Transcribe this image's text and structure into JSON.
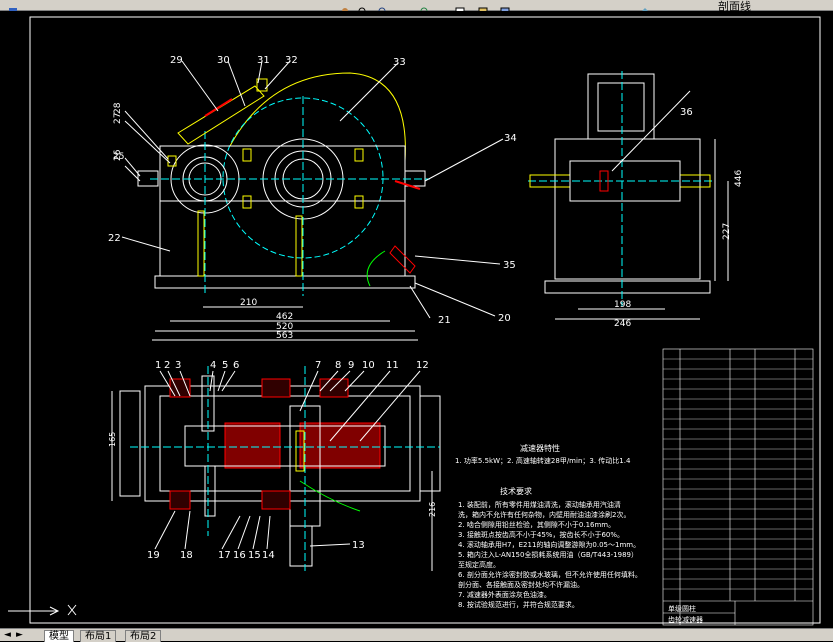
{
  "toolbar": {
    "layer_name": "剖面线",
    "icons": [
      "help-icon",
      "pan-icon",
      "zoom-realtime-icon",
      "zoom-window-icon",
      "zoom-previous-icon",
      "properties-icon",
      "design-center-icon",
      "tool-palette-icon",
      "layer-icon"
    ]
  },
  "drawing": {
    "part_numbers_front": [
      "29",
      "30",
      "31",
      "32",
      "33",
      "28",
      "27",
      "26",
      "25",
      "34",
      "22",
      "35",
      "21",
      "20"
    ],
    "part_numbers_side": [
      "36"
    ],
    "part_numbers_top": [
      "1",
      "2",
      "3",
      "4",
      "5",
      "6",
      "7",
      "8",
      "9",
      "10",
      "11",
      "12",
      "19",
      "18",
      "17",
      "16",
      "15",
      "14",
      "13"
    ],
    "dim_front": [
      "210",
      "462",
      "520",
      "563"
    ],
    "dim_side": [
      "198",
      "246",
      "446",
      "227"
    ],
    "dim_top_left": "165",
    "dim_top_right": "216",
    "characteristics_title": "减速器特性",
    "characteristics_text": "1. 功率5.5kW；2. 高速轴转速28甲/min；3. 传动比1.4",
    "tech_title": "技术要求",
    "tech_lines": [
      "1. 装配前，所有零件用煤油清洗，滚动轴承用汽油清",
      "洗，箱内不允许有任何杂物，内壁用耐油油漆涂刷2次。",
      "2. 啮合侧隙用铅丝检验，其侧隙不小于0.16mm。",
      "3. 接触斑点按齿高不小于45%，按齿长不小于60%。",
      "4. 滚动轴承用H7，E211的轴向调整游隙为0.05～1mm。",
      "5. 箱内注入L-AN150全损耗系统用油（GB/T443-1989）",
      "至规定高度。",
      "6. 剖分面允许涂密封胶或水玻璃，但不允许使用任何填料。",
      "剖分面、各接触面及密封处均不许漏油。",
      "7. 减速器外表面涂灰色油漆。",
      "8. 按试验规范进行，并符合规范要求。"
    ],
    "title_block": {
      "name_line1": "单级圆柱",
      "name_line2": "齿轮减速器"
    }
  },
  "layout_tabs": {
    "nav": [
      "◄",
      "►"
    ],
    "items": [
      "模型",
      "布局1",
      "布局2"
    ],
    "active": 0
  },
  "colors": {
    "yellow": "#ffff00",
    "white": "#ffffff",
    "cyan": "#00ffff",
    "red": "#ff0000",
    "green": "#00ff00",
    "magenta": "#ff00ff"
  }
}
